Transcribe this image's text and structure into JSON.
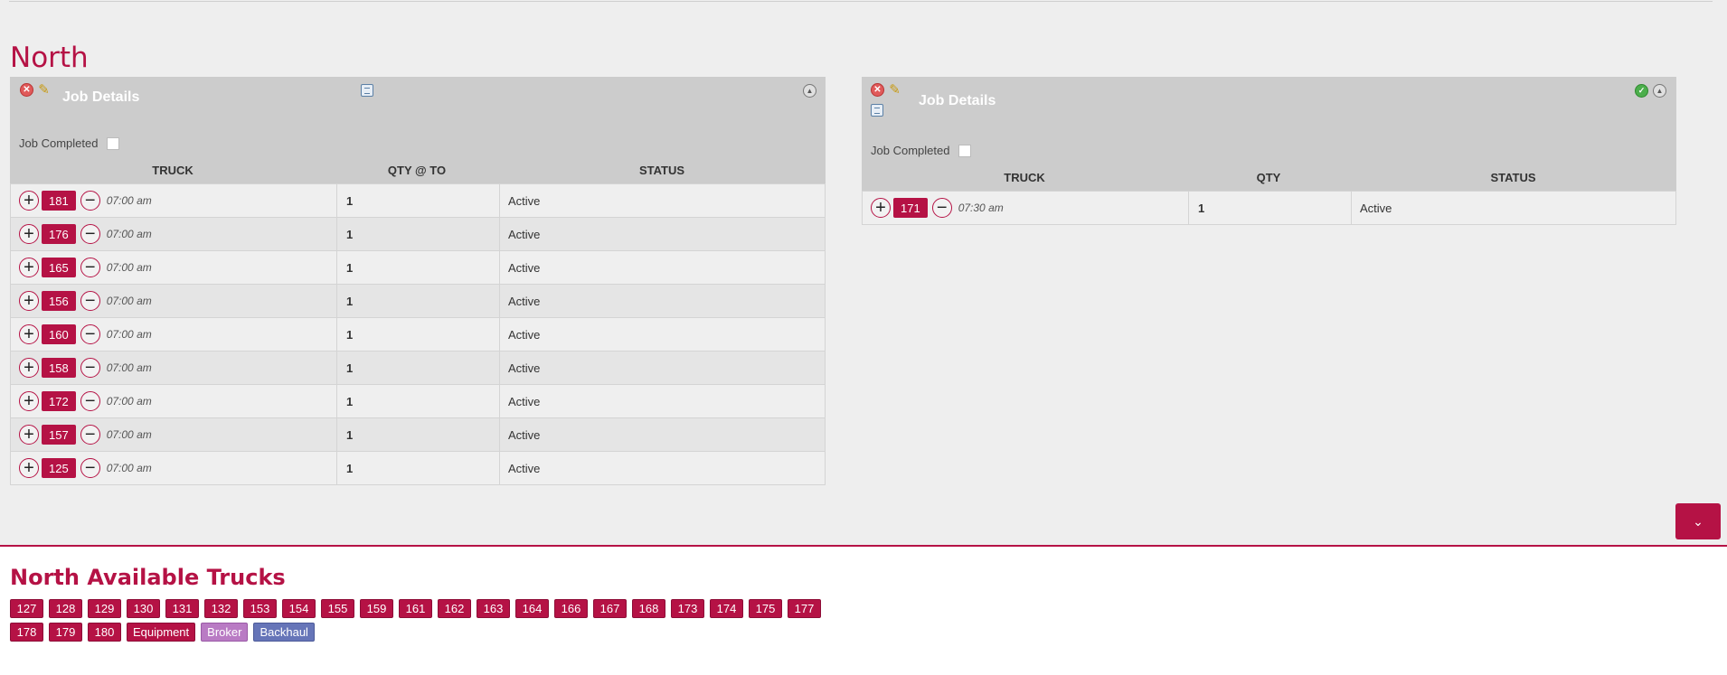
{
  "region": {
    "title": "North"
  },
  "panels": [
    {
      "title": "Job Details",
      "job_completed_label": "Job Completed",
      "columns": [
        "TRUCK",
        "QTY @ TO",
        "STATUS"
      ],
      "rows": [
        {
          "truck": "181",
          "time": "07:00 am",
          "qty": "1",
          "status": "Active"
        },
        {
          "truck": "176",
          "time": "07:00 am",
          "qty": "1",
          "status": "Active"
        },
        {
          "truck": "165",
          "time": "07:00 am",
          "qty": "1",
          "status": "Active"
        },
        {
          "truck": "156",
          "time": "07:00 am",
          "qty": "1",
          "status": "Active"
        },
        {
          "truck": "160",
          "time": "07:00 am",
          "qty": "1",
          "status": "Active"
        },
        {
          "truck": "158",
          "time": "07:00 am",
          "qty": "1",
          "status": "Active"
        },
        {
          "truck": "172",
          "time": "07:00 am",
          "qty": "1",
          "status": "Active"
        },
        {
          "truck": "157",
          "time": "07:00 am",
          "qty": "1",
          "status": "Active"
        },
        {
          "truck": "125",
          "time": "07:00 am",
          "qty": "1",
          "status": "Active"
        }
      ]
    },
    {
      "title": "Job Details",
      "job_completed_label": "Job Completed",
      "columns": [
        "TRUCK",
        "QTY",
        "STATUS"
      ],
      "rows": [
        {
          "truck": "171",
          "time": "07:30 am",
          "qty": "1",
          "status": "Active"
        }
      ]
    }
  ],
  "icons": {
    "close": "close-icon",
    "edit": "pencil-icon",
    "copy": "copy-icon",
    "collapse": "collapse-up-icon",
    "complete": "check-icon",
    "add": "plus-icon",
    "remove": "minus-icon",
    "scroll": "chevron-down-icon"
  },
  "available": {
    "title": "North Available Trucks",
    "trucks": [
      "127",
      "128",
      "129",
      "130",
      "131",
      "132",
      "153",
      "154",
      "155",
      "159",
      "161",
      "162",
      "163",
      "164",
      "166",
      "167",
      "168",
      "173",
      "174",
      "175",
      "177",
      "178",
      "179",
      "180"
    ],
    "specials": [
      {
        "label": "Equipment",
        "kind": "equipment"
      },
      {
        "label": "Broker",
        "kind": "broker"
      },
      {
        "label": "Backhaul",
        "kind": "backhaul"
      }
    ]
  },
  "colors": {
    "brand": "#b51245",
    "broker": "#b97bc4",
    "backhaul": "#6675b8",
    "panel_header": "#cccccc"
  }
}
